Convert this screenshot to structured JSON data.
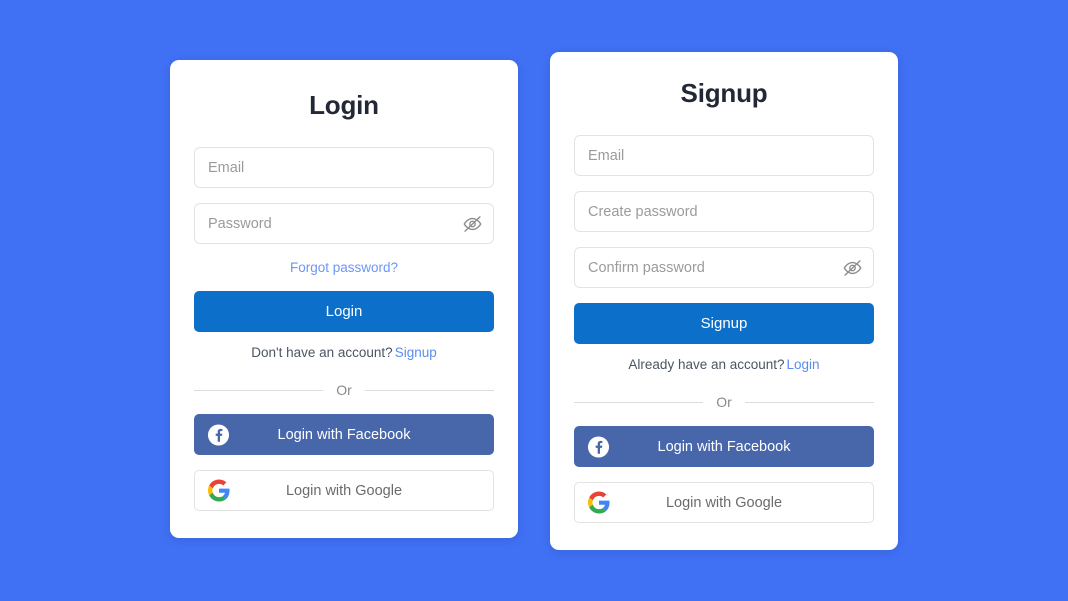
{
  "page": {
    "background_color": "#4070f4"
  },
  "colors": {
    "background": "#4070f4",
    "primary_button": "#0c6fc9",
    "facebook_button": "#4867aa",
    "link": "#5b8def",
    "forgot_link": "#6d96f5",
    "card": "#ffffff",
    "input_border": "#e3e3e3",
    "placeholder": "#9b9b9b",
    "title": "#232836",
    "divider": "#dcdcdc",
    "or_text": "#8a8a8a"
  },
  "login_card": {
    "title": "Login",
    "fields": [
      {
        "name": "email",
        "placeholder": "Email",
        "type": "email",
        "value": "",
        "has_toggle": false
      },
      {
        "name": "password",
        "placeholder": "Password",
        "type": "password",
        "value": "",
        "has_toggle": true,
        "toggle_icon": "eye-off-icon"
      }
    ],
    "forgot_password_label": "Forgot password?",
    "submit_label": "Login",
    "switch_prompt": "Don't have an account?",
    "switch_link_label": "Signup",
    "divider_label": "Or",
    "social": [
      {
        "name": "facebook",
        "label": "Login with Facebook",
        "icon": "facebook-icon"
      },
      {
        "name": "google",
        "label": "Login with Google",
        "icon": "google-icon"
      }
    ]
  },
  "signup_card": {
    "title": "Signup",
    "fields": [
      {
        "name": "email",
        "placeholder": "Email",
        "type": "email",
        "value": "",
        "has_toggle": false
      },
      {
        "name": "create-password",
        "placeholder": "Create password",
        "type": "password",
        "value": "",
        "has_toggle": false
      },
      {
        "name": "confirm-password",
        "placeholder": "Confirm password",
        "type": "password",
        "value": "",
        "has_toggle": true,
        "toggle_icon": "eye-off-icon"
      }
    ],
    "submit_label": "Signup",
    "switch_prompt": "Already have an account?",
    "switch_link_label": "Login",
    "divider_label": "Or",
    "social": [
      {
        "name": "facebook",
        "label": "Login with Facebook",
        "icon": "facebook-icon"
      },
      {
        "name": "google",
        "label": "Login with Google",
        "icon": "google-icon"
      }
    ]
  }
}
